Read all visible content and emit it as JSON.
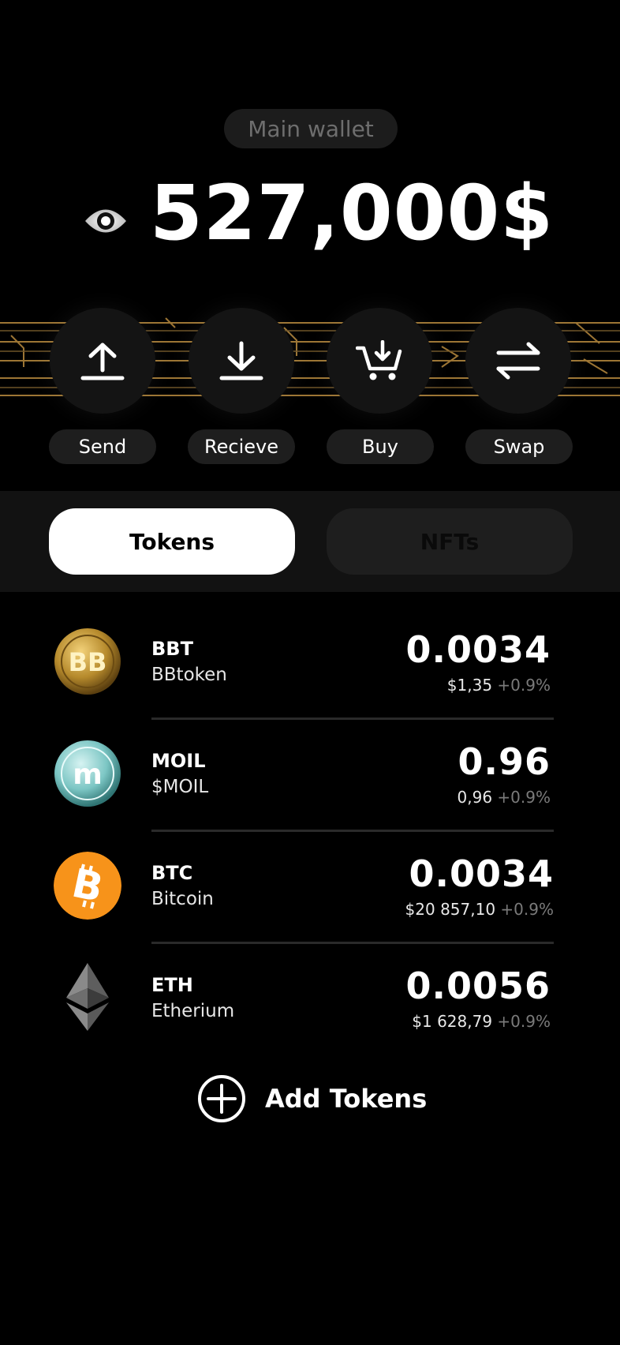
{
  "wallet": {
    "title": "Main wallet",
    "balance": "527,000$"
  },
  "actions": [
    {
      "label": "Send",
      "icon": "upload-arrow-icon"
    },
    {
      "label": "Recieve",
      "icon": "download-arrow-icon"
    },
    {
      "label": "Buy",
      "icon": "cart-icon"
    },
    {
      "label": "Swap",
      "icon": "swap-arrows-icon"
    }
  ],
  "tabs": [
    {
      "label": "Tokens",
      "active": true
    },
    {
      "label": "NFTs",
      "active": false
    }
  ],
  "tokens": [
    {
      "symbol": "BBT",
      "name": "BBtoken",
      "amount": "0.0034",
      "fiat": "$1,35",
      "change": "+0.9%",
      "icon": "bbtoken-coin-icon"
    },
    {
      "symbol": "MOIL",
      "name": "$MOIL",
      "amount": "0.96",
      "fiat": "0,96",
      "change": "+0.9%",
      "icon": "moil-coin-icon"
    },
    {
      "symbol": "BTC",
      "name": "Bitcoin",
      "amount": "0.0034",
      "fiat": "$20 857,10",
      "change": "+0.9%",
      "icon": "bitcoin-icon"
    },
    {
      "symbol": "ETH",
      "name": "Etherium",
      "amount": "0.0056",
      "fiat": "$1 628,79",
      "change": "+0.9%",
      "icon": "ethereum-icon"
    }
  ],
  "add_tokens": {
    "label": "Add Tokens",
    "icon": "plus-circle-icon"
  },
  "colors": {
    "background": "#000000",
    "pill": "#1e1e1e",
    "circuit_gold": "#b88a3e",
    "bitcoin_orange": "#f7931a",
    "muted_text": "#7a7a7a"
  }
}
